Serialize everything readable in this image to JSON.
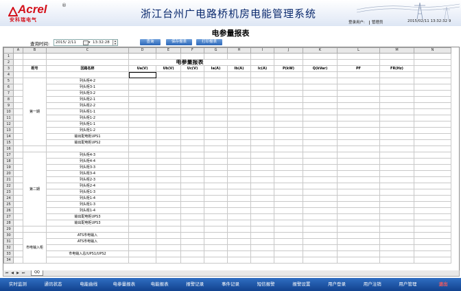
{
  "brand": {
    "name": "Acrel",
    "subtitle": "安科瑞电气",
    "reg": "®"
  },
  "system_title": "浙江台州广电路桥机房电能管理系统",
  "user": {
    "label": "登录用户:",
    "name": "管理员",
    "datetime": "2015/02/11    13:32:32 9"
  },
  "report_title": "电参量报表",
  "query": {
    "label": "查询时间:",
    "date": "2015/ 2/11",
    "time": "13:32:28",
    "buttons": {
      "query": "查询",
      "save": "保存报表",
      "print": "打印报表"
    }
  },
  "sheet": {
    "col_letters": [
      "",
      "A",
      "B",
      "C",
      "D",
      "E",
      "F",
      "G",
      "H",
      "I",
      "J",
      "K",
      "L",
      "M",
      "N"
    ],
    "title": "电参量报表",
    "headers": [
      "柜号",
      "回路名称",
      "Ua(V)",
      "Ub(V)",
      "Uc(V)",
      "Ia(A)",
      "Ib(A)",
      "Ic(A)",
      "P(kW)",
      "Q(kVar)",
      "PF",
      "FR(Hz)"
    ],
    "period1": "第一期",
    "period1_rows": [
      "列头柜4-2",
      "列头柜3-1",
      "列头柜3-2",
      "列头柜2-1",
      "列头柜2-2",
      "列头柜1-1",
      "列头柜1-2",
      "列头柜1-1",
      "列头柜1-2",
      "输出配电柜UPS1",
      "输出配电柜UPS2"
    ],
    "period2": "第二期",
    "period2_rows": [
      "列头柜4-3",
      "列头柜4-4",
      "列头柜3-3",
      "列头柜3-4",
      "列头柜2-3",
      "列头柜2-4",
      "列头柜1-3",
      "列头柜1-4",
      "列头柜1-3",
      "列头柜1-4",
      "输出配电柜UPS3",
      "输出配电柜UPS3"
    ],
    "period3": "市电输入柜",
    "period3_rows": [
      "ATS市电输入",
      "ATS市电输入",
      "市电输入总/UPS1/UPS2"
    ],
    "tab": "QQ"
  },
  "nav": [
    "实时监测",
    "通讯状态",
    "电能曲线",
    "电参量报表",
    "电能报表",
    "报警记录",
    "事件记录",
    "短信报警",
    "报警设置",
    "用户登录",
    "用户注销",
    "用户管理",
    "退出"
  ],
  "colors": {
    "nav_bg": "#1f58a8",
    "title": "#0b2a6e",
    "brand": "#d4101a",
    "exit": "#ff5a5a"
  }
}
